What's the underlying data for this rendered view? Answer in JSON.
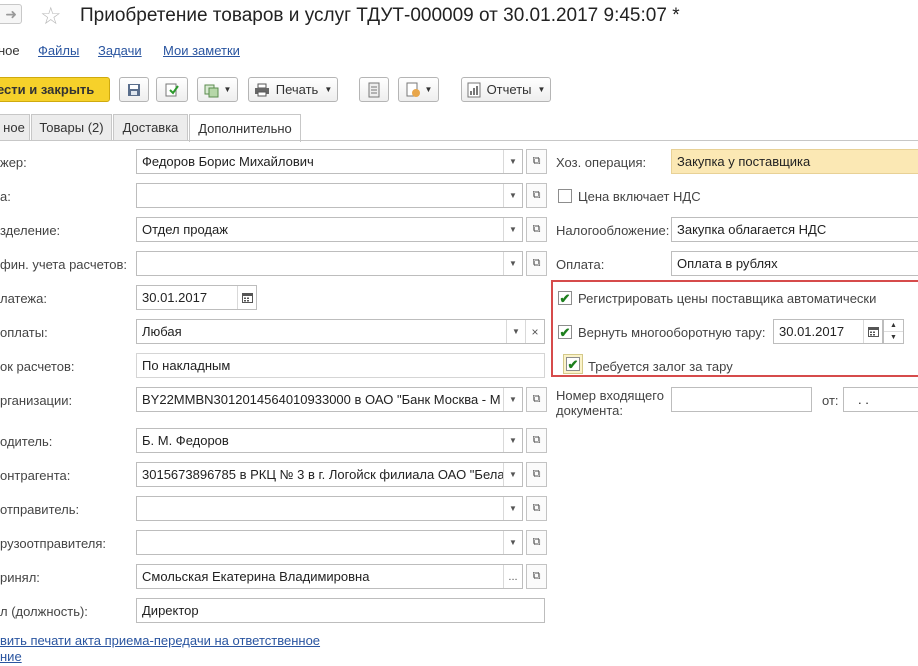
{
  "window": {
    "title": "Приобретение товаров и услуг ТДУТ-000009 от 30.01.2017 9:45:07 *"
  },
  "nav": {
    "current": "ное",
    "links": [
      "Файлы",
      "Задачи",
      "Мои заметки"
    ]
  },
  "toolbar": {
    "post_close": "ести и закрыть",
    "print": "Печать",
    "reports": "Отчеты"
  },
  "tabs": [
    "ное",
    "Товары (2)",
    "Доставка",
    "Дополнительно"
  ],
  "left_form": {
    "rows": [
      {
        "label": "жер:",
        "value": "Федоров Борис Михайлович"
      },
      {
        "label": "а:",
        "value": ""
      },
      {
        "label": "зделение:",
        "value": "Отдел продаж"
      },
      {
        "label": "фин. учета расчетов:",
        "value": ""
      },
      {
        "label": "латежа:",
        "value": "30.01.2017"
      },
      {
        "label": "оплаты:",
        "value": "Любая"
      },
      {
        "label": "ок расчетов:",
        "value": "По накладным"
      },
      {
        "label": "рганизации:",
        "value": "BY22MMBN3012014564010933000 в ОАО \"Банк Москва - М"
      },
      {
        "label": "одитель:",
        "value": "Б. М. Федоров"
      },
      {
        "label": "онтрагента:",
        "value": "3015673896785 в РКЦ № 3 в г. Логойск филиала ОАО \"Бела"
      },
      {
        "label": "отправитель:",
        "value": ""
      },
      {
        "label": "рузоотправителя:",
        "value": ""
      },
      {
        "label": "ринял:",
        "value": "Смольская Екатерина Владимировна"
      },
      {
        "label": "л (должность):",
        "value": "Директор"
      }
    ],
    "bottom_link_1": "вить печати акта приема-передачи на ответственное",
    "bottom_link_2": "ние"
  },
  "right_form": {
    "op_label": "Хоз. операция:",
    "op_value": "Закупка у поставщика",
    "vat_included": "Цена включает НДС",
    "tax_label": "Налогообложение:",
    "tax_value": "Закупка облагается НДС",
    "pay_label": "Оплата:",
    "pay_value": "Оплата в рублях",
    "register_prices": "Регистрировать цены поставщика автоматически",
    "return_tare": "Вернуть многооборотную тару:",
    "return_date": "30.01.2017",
    "deposit": "Требуется залог за тару",
    "incoming_doc_label_1": "Номер входящего",
    "incoming_doc_label_2": "документа:",
    "from_label": "от:",
    "from_value": ".   ."
  },
  "icons": {
    "dropdown": "▾",
    "open": "⧉",
    "calendar": "calendar-icon",
    "check": "✔",
    "clear": "×",
    "ellipsis": "..."
  },
  "colors": {
    "primary_button": "#f6d12a",
    "highlight_field": "#fbe8b4",
    "red_frame": "#d64b4b",
    "link": "#2a55a0"
  }
}
